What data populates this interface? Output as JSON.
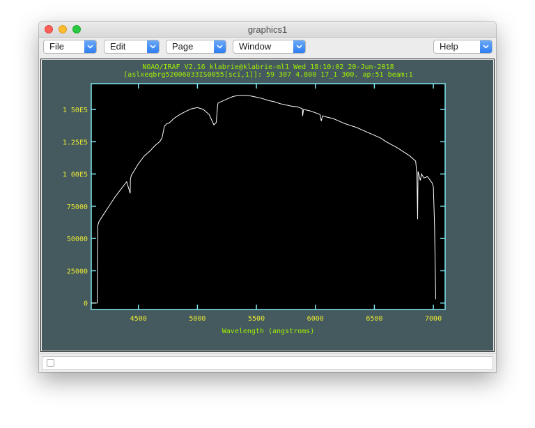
{
  "window": {
    "title": "graphics1"
  },
  "menus": [
    {
      "label": "File"
    },
    {
      "label": "Edit"
    },
    {
      "label": "Page"
    },
    {
      "label": "Window"
    },
    {
      "label": "Help"
    }
  ],
  "colors": {
    "plot_background": "#000000",
    "frame_background": "#455a5f",
    "axis": "#7fe7f0",
    "header_text": "#a0f000",
    "tick_label": "#e9e932",
    "spectrum": "#ffffff"
  },
  "chart_data": {
    "type": "line",
    "header_line1": "NOAO/IRAF V2.16 klabrie@klabrie-ml1 Wed 18:10:02 20-Jun-2018",
    "header_line2": "[aslxeqbrg52006033IS0055[sci,1]]: 59 307   4.800 17_1 300. ap:51 beam:1",
    "xlabel": "Wavelength (angstroms)",
    "ylabel": "",
    "xlim": [
      4100,
      7100
    ],
    "ylim": [
      -5000,
      170000
    ],
    "xticks": [
      4500,
      5000,
      5500,
      6000,
      6500,
      7000
    ],
    "xtick_labels": [
      "4500",
      "5000",
      "5500",
      "6000",
      "6500",
      "7000"
    ],
    "yticks": [
      0,
      25000,
      50000,
      75000,
      100000,
      125000,
      150000
    ],
    "ytick_labels": [
      "0",
      "25000",
      "50000",
      "75000",
      "1 00E5",
      "1.25E5",
      "1 50E5"
    ],
    "grid": false,
    "series": [
      {
        "x": [
          4100,
          4140,
          4150,
          4155,
          4165,
          4200,
          4250,
          4300,
          4350,
          4400,
          4430,
          4432,
          4440,
          4460,
          4500,
          4550,
          4600,
          4640,
          4680,
          4700,
          4720,
          4740,
          4760,
          4800,
          4850,
          4900,
          4950,
          5000,
          5050,
          5100,
          5140,
          5160,
          5170,
          5175,
          5200,
          5250,
          5300,
          5350,
          5400,
          5450,
          5500,
          5550,
          5600,
          5650,
          5700,
          5750,
          5800,
          5850,
          5890,
          5892,
          5900,
          5950,
          6000,
          6040,
          6050,
          6060,
          6100,
          6150,
          6200,
          6250,
          6300,
          6350,
          6400,
          6450,
          6500,
          6550,
          6600,
          6650,
          6700,
          6750,
          6800,
          6850,
          6860,
          6867,
          6870,
          6890,
          6900,
          6920,
          6950,
          6990,
          7000,
          7010,
          7020
        ],
        "y": [
          0,
          0,
          0,
          60000,
          63000,
          68000,
          75000,
          82000,
          88000,
          94000,
          85000,
          96000,
          99000,
          102000,
          108000,
          114000,
          118000,
          122000,
          125000,
          128000,
          137000,
          139000,
          139500,
          143000,
          146000,
          148500,
          150500,
          151500,
          150000,
          146000,
          138000,
          140000,
          152000,
          155000,
          156000,
          158000,
          160000,
          161000,
          161000,
          160500,
          159500,
          158500,
          157000,
          156000,
          154500,
          153500,
          152500,
          152000,
          150500,
          145000,
          150000,
          149000,
          147500,
          146000,
          141000,
          145000,
          144000,
          143000,
          141000,
          139000,
          137500,
          136000,
          134000,
          132000,
          130000,
          128000,
          125000,
          122500,
          120000,
          117000,
          114000,
          110000,
          100000,
          65000,
          102000,
          95000,
          100000,
          97000,
          98000,
          93000,
          90000,
          60000,
          3000
        ]
      }
    ]
  }
}
